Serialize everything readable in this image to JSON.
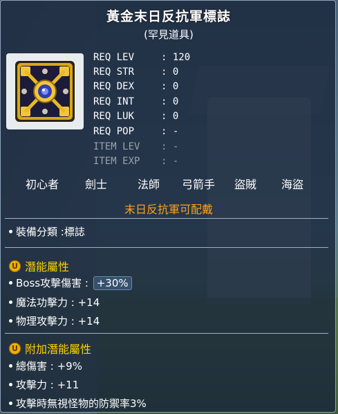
{
  "item": {
    "name": "黃金末日反抗軍標誌",
    "rarity": "(罕見道具)",
    "icon": "golden-resistance-emblem-icon"
  },
  "requirements": [
    {
      "key": "REQ LEV",
      "value": ": 120"
    },
    {
      "key": "REQ STR",
      "value": ": 0"
    },
    {
      "key": "REQ DEX",
      "value": ": 0"
    },
    {
      "key": "REQ INT",
      "value": ": 0"
    },
    {
      "key": "REQ LUK",
      "value": ": 0"
    },
    {
      "key": "REQ POP",
      "value": ": -"
    },
    {
      "key": "ITEM LEV",
      "value": ": -"
    },
    {
      "key": "ITEM EXP",
      "value": ": -"
    }
  ],
  "jobs": [
    "初心者",
    "劍士",
    "法師",
    "弓箭手",
    "盜賊",
    "海盜"
  ],
  "notice": "末日反抗軍可配戴",
  "category": "裝備分類 :標誌",
  "potential": {
    "header": "潛能屬性",
    "badge": "U",
    "lines": [
      {
        "label": "Boss攻擊傷害 : ",
        "value": "+30%"
      },
      {
        "label": "魔法功擊力 : +14"
      },
      {
        "label": "物理攻擊力 : +14"
      }
    ]
  },
  "bonus_potential": {
    "header": "附加潛能屬性",
    "badge": "U",
    "lines": [
      "總傷害 : +9%",
      "攻擊力 : +11",
      "攻擊時無視怪物的防禦率3%"
    ]
  },
  "colors": {
    "title": "#ffffff",
    "notice": "#ffa11a",
    "section_header": "#ffd200",
    "dim_text": "#9aa3ad"
  }
}
